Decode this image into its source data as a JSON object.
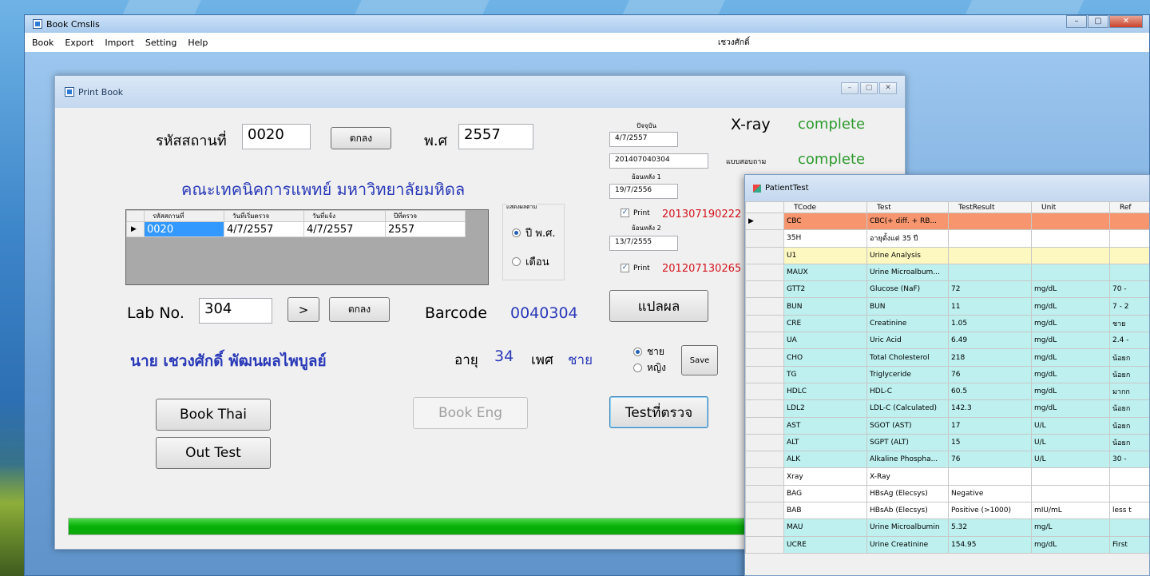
{
  "app": {
    "title": "Book Cmslis",
    "user": "เชวงศักดิ์",
    "menu": [
      "Book",
      "Export",
      "Import",
      "Setting",
      "Help"
    ]
  },
  "print_book": {
    "title": "Print Book",
    "site_code_label": "รหัสสถานที่",
    "site_code_value": "0020",
    "ok_label": "ตกลง",
    "be_year_label": "พ.ศ",
    "be_year_value": "2557",
    "org_name": "คณะเทคนิคการแพทย์ มหาวิทยาลัยมหิดล",
    "grid": {
      "headers": [
        "รหัสสถานที่",
        "วันที่เริ่มตรวจ",
        "วันที่แจ้ง",
        "ปีที่ตรวจ"
      ],
      "row": [
        "0020",
        "4/7/2557",
        "4/7/2557",
        "2557"
      ],
      "row_marker": "▶"
    },
    "period_group_label": "แสดงผลตาม",
    "radio_year": "ปี พ.ศ.",
    "radio_month": "เดือน",
    "lab_no_label": "Lab No.",
    "lab_no_value": "304",
    "next_label": ">",
    "ok2_label": "ตกลง",
    "barcode_label": "Barcode",
    "barcode_value": "0040304",
    "patient_name": "นาย เชวงศักดิ์ พัฒนผลไพบูลย์",
    "age_label": "อายุ",
    "age_value": "34",
    "sex_label": "เพศ",
    "sex_value": "ชาย",
    "radio_male": "ชาย",
    "radio_female": "หญิง",
    "save_label": "Save",
    "current_label": "ปัจจุบัน",
    "current_date": "4/7/2557",
    "current_code": "201407040304",
    "back1_label": "ย้อนหลัง 1",
    "back1_date": "19/7/2556",
    "back1_print_label": "Print",
    "back1_code": "201307190222",
    "back2_label": "ย้อนหลัง 2",
    "back2_date": "13/7/2555",
    "back2_print_label": "Print",
    "back2_code": "201207130265",
    "xray_label": "X-ray",
    "xray_status": "complete",
    "survey_label": "แบบสอบถาม",
    "survey_status": "complete",
    "translate_label": "แปลผล",
    "book_thai_label": "Book Thai",
    "book_eng_label": "Book Eng",
    "tests_label": "Testที่ตรวจ",
    "out_test_label": "Out Test",
    "progress": 1.0
  },
  "patient_test": {
    "title": "PatientTest",
    "columns": [
      "TCode",
      "Test",
      "TestResult",
      "Unit",
      "Ref"
    ],
    "rows": [
      {
        "marker": "▶",
        "color": "orange",
        "cells": [
          "CBC",
          "CBC(+ diff. + RB...",
          "",
          "",
          ""
        ]
      },
      {
        "marker": "",
        "color": "white",
        "cells": [
          "35H",
          "อายุตั้งแต่ 35 ปี",
          "",
          "",
          ""
        ]
      },
      {
        "marker": "",
        "color": "yellow",
        "cells": [
          "U1",
          "Urine Analysis",
          "",
          "",
          ""
        ]
      },
      {
        "marker": "",
        "color": "cyan",
        "cells": [
          "MAUX",
          "Urine Microalbum...",
          "",
          "",
          ""
        ]
      },
      {
        "marker": "",
        "color": "cyan",
        "cells": [
          "GTT2",
          "Glucose (NaF)",
          "72",
          "mg/dL",
          "70 -"
        ]
      },
      {
        "marker": "",
        "color": "cyan",
        "cells": [
          "BUN",
          "BUN",
          "11",
          "mg/dL",
          "7 - 2"
        ]
      },
      {
        "marker": "",
        "color": "cyan",
        "cells": [
          "CRE",
          "Creatinine",
          "1.05",
          "mg/dL",
          "ชาย"
        ]
      },
      {
        "marker": "",
        "color": "cyan",
        "cells": [
          "UA",
          "Uric Acid",
          "6.49",
          "mg/dL",
          "2.4 -"
        ]
      },
      {
        "marker": "",
        "color": "cyan",
        "cells": [
          "CHO",
          "Total Cholesterol",
          "218",
          "mg/dL",
          "น้อยก"
        ]
      },
      {
        "marker": "",
        "color": "cyan",
        "cells": [
          "TG",
          "Triglyceride",
          "76",
          "mg/dL",
          "น้อยก"
        ]
      },
      {
        "marker": "",
        "color": "cyan",
        "cells": [
          "HDLC",
          "HDL-C",
          "60.5",
          "mg/dL",
          "มากก"
        ]
      },
      {
        "marker": "",
        "color": "cyan",
        "cells": [
          "LDL2",
          "LDL-C (Calculated)",
          "142.3",
          "mg/dL",
          "น้อยก"
        ]
      },
      {
        "marker": "",
        "color": "cyan",
        "cells": [
          "AST",
          "SGOT (AST)",
          "17",
          "U/L",
          "น้อยก"
        ]
      },
      {
        "marker": "",
        "color": "cyan",
        "cells": [
          "ALT",
          "SGPT (ALT)",
          "15",
          "U/L",
          "น้อยก"
        ]
      },
      {
        "marker": "",
        "color": "cyan",
        "cells": [
          "ALK",
          "Alkaline Phospha...",
          "76",
          "U/L",
          "30 -"
        ]
      },
      {
        "marker": "",
        "color": "white",
        "cells": [
          "Xray",
          "X-Ray",
          "",
          "",
          ""
        ]
      },
      {
        "marker": "",
        "color": "white",
        "cells": [
          "BAG",
          "HBsAg (Elecsys)",
          "Negative",
          "",
          ""
        ]
      },
      {
        "marker": "",
        "color": "white",
        "cells": [
          "BAB",
          "HBsAb (Elecsys)",
          "Positive (>1000)",
          "mIU/mL",
          "less t"
        ]
      },
      {
        "marker": "",
        "color": "cyan",
        "cells": [
          "MAU",
          "Urine Microalbumin",
          "5.32",
          "mg/L",
          ""
        ]
      },
      {
        "marker": "",
        "color": "cyan",
        "cells": [
          "UCRE",
          "Urine Creatinine",
          "154.95",
          "mg/dL",
          "First"
        ]
      }
    ]
  },
  "colors": {
    "status_complete": "#2e9a2e",
    "name_blue": "#2a3ab8",
    "code_red": "#d4141e",
    "progress_green": "#06b006"
  }
}
